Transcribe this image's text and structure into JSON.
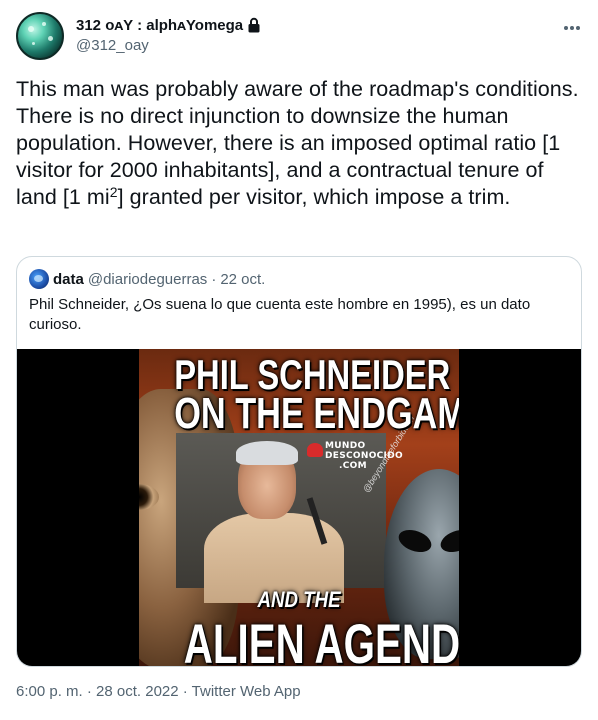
{
  "author": {
    "display_name": "312 ᴏᴀY : alphᴀYomega",
    "handle": "@312_oay",
    "avatar_icon": "green-orb-avatar",
    "protected_icon": "lock-icon"
  },
  "menu": {
    "more_icon": "more-horizontal-icon"
  },
  "tweet": {
    "text_before_sup": "This man was probably aware of the roadmap's conditions. There is no direct injunction to downsize the human population. However, there is an imposed optimal ratio [1 visitor for 2000 inhabitants], and a contractual tenure of land [1 mi",
    "sup": "2",
    "text_after_sup": "] granted per visitor, which impose a trim."
  },
  "quote": {
    "name": "data",
    "handle": "@diariodeguerras",
    "separator": "·",
    "date": "22 oct.",
    "text": "Phil Schneider, ¿Os suena lo que cuenta este hombre en 1995), es un dato curioso.",
    "media": {
      "title_line1": "PHIL SCHNEIDER",
      "title_line2": "ON THE ENDGAME",
      "subtitle": "AND THE",
      "title_line3": "ALIEN AGENDA",
      "logo_line1": "MUNDO",
      "logo_line2": "DESCONOCIDO",
      "logo_line3": ".COM",
      "watermark": "@beyondtheforbidden"
    }
  },
  "meta": {
    "text": "6:00 p. m. · 28 oct. 2022 · Twitter Web App"
  },
  "colors": {
    "text_primary": "#0f1419",
    "text_secondary": "#536471",
    "border": "#cfd9de"
  }
}
